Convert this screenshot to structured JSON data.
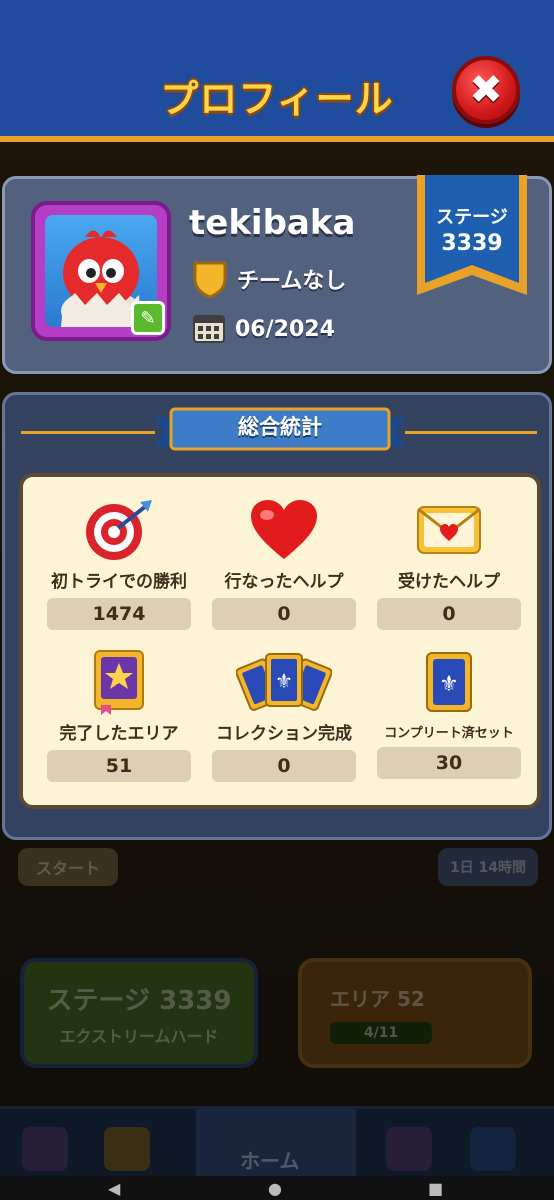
{
  "header": {
    "title": "プロフィール",
    "close_label": "✖"
  },
  "profile": {
    "username": "tekibaka",
    "team": "チームなし",
    "joined": "06/2024",
    "stage_label": "ステージ",
    "stage_value": "3339"
  },
  "stats": {
    "section_title": "総合統計",
    "items": [
      {
        "label": "初トライでの勝利",
        "value": "1474",
        "icon": "target-icon"
      },
      {
        "label": "行なったヘルプ",
        "value": "0",
        "icon": "heart-icon"
      },
      {
        "label": "受けたヘルプ",
        "value": "0",
        "icon": "envelope-icon"
      },
      {
        "label": "完了したエリア",
        "value": "51",
        "icon": "book-star-icon"
      },
      {
        "label": "コレクション完成",
        "value": "0",
        "icon": "cards-fan-icon"
      },
      {
        "label": "コンプリート済セット",
        "value": "30",
        "icon": "card-icon"
      }
    ]
  },
  "background": {
    "start_label": "スタート",
    "timer_label": "1日 14時間",
    "stage_button": "ステージ 3339",
    "stage_difficulty": "エクストリームハード",
    "area_label": "エリア 52",
    "area_progress": "4/11",
    "area_progress_fraction": 0.36,
    "home_tab": "ホーム"
  },
  "colors": {
    "header_bg": "#1f4c9c",
    "accent_gold": "#e7a227",
    "title_yellow": "#ffd34a",
    "close_red": "#d01818",
    "card_bg": "#52627e",
    "panel_bg": "#fdf4d6"
  }
}
